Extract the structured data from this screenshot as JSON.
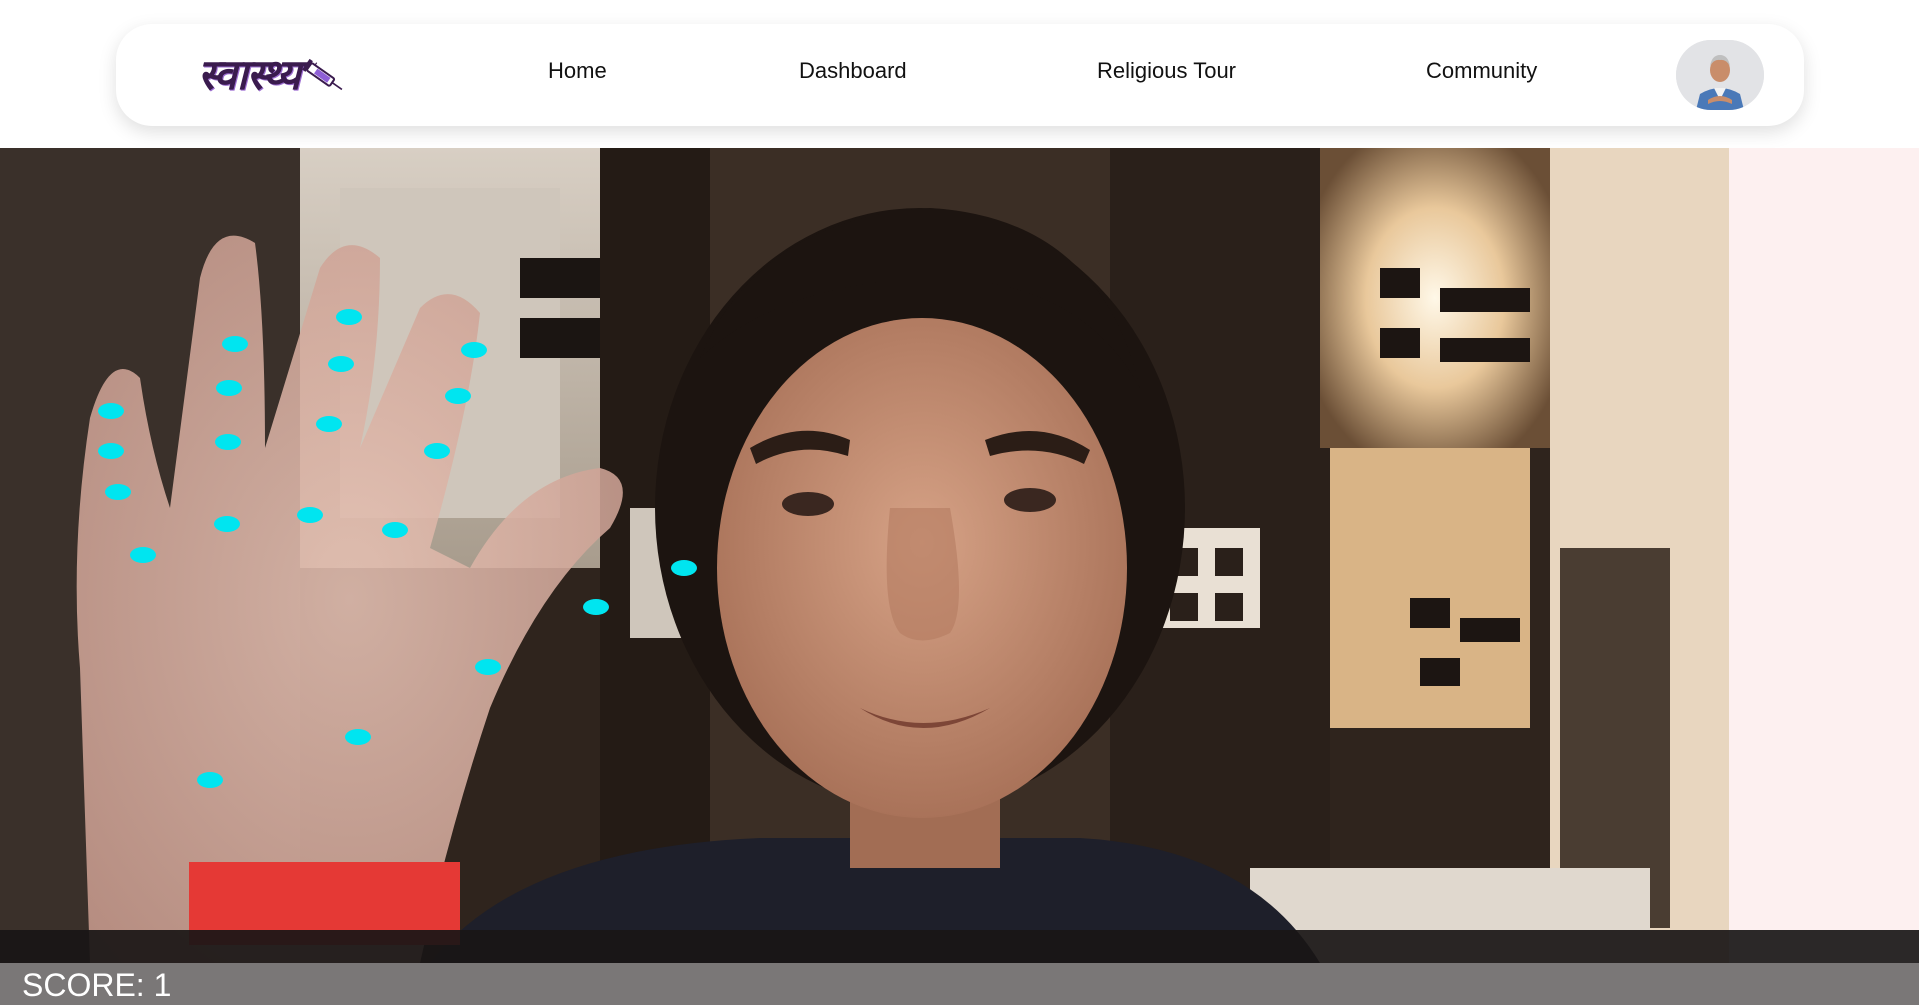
{
  "navbar": {
    "logo_text": "स्वास्थ्य",
    "links": {
      "home": "Home",
      "dashboard": "Dashboard",
      "religious_tour": "Religious Tour",
      "community": "Community"
    },
    "avatar_icon": "user-avatar-icon"
  },
  "game": {
    "score_label": "SCORE: 1",
    "landmark_color": "#00e5f0",
    "target_color": "#e53935"
  },
  "colors": {
    "right_panel": "#fdf0f0",
    "score_bar": "#7a7777"
  }
}
